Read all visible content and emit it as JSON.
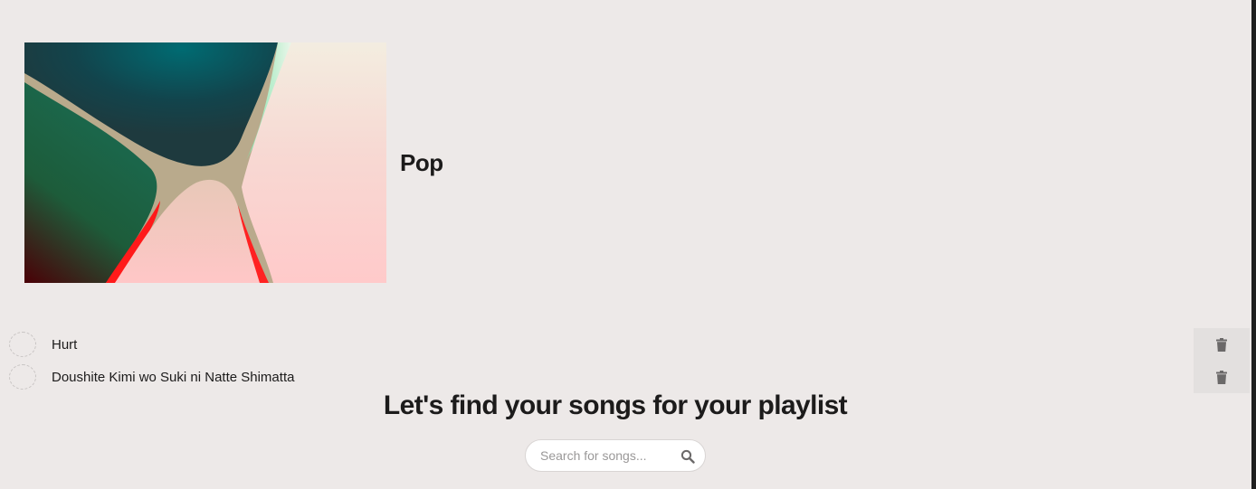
{
  "playlist": {
    "name": "Pop",
    "cover_icon": "abstract-gradient-artwork"
  },
  "songs": [
    {
      "title": "Hurt"
    },
    {
      "title": "Doushite Kimi wo Suki ni Natte Shimatta"
    }
  ],
  "search": {
    "heading": "Let's find your songs for your playlist",
    "placeholder": "Search for songs...",
    "icon": "search-icon"
  },
  "colors": {
    "background": "#ede9e8",
    "delete_button_bg": "#e3e0df",
    "icon_gray": "#6b6969"
  }
}
